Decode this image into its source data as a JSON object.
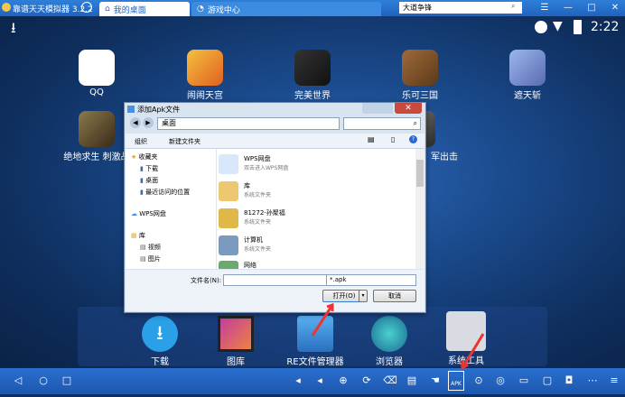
{
  "titlebar": {
    "app_name": "靠谱天天模拟器 3.2.2",
    "tab_desktop": "我的桌面",
    "tab_game_center": "游戏中心",
    "search_value": "大道争锋"
  },
  "statusbar": {
    "time": "2:22"
  },
  "desktop": {
    "row1": [
      {
        "label": "QQ",
        "icon": "qq-icon",
        "color": "#ffffff"
      },
      {
        "label": "闹闹天宫",
        "icon": "game-icon",
        "color": "#f5a623"
      },
      {
        "label": "完美世界",
        "icon": "game-icon",
        "color": "#2a2a2a"
      },
      {
        "label": "乐可三国",
        "icon": "game-icon",
        "color": "#8a5a2a"
      },
      {
        "label": "遮天斩",
        "icon": "game-icon",
        "color": "#7a9ad8"
      }
    ],
    "row2": [
      {
        "label": "绝地求生 刺激战",
        "icon": "game-icon",
        "color": "#6a5a3a"
      },
      {
        "label": "军出击",
        "icon": "game-icon",
        "color": "#4a4a4a"
      }
    ]
  },
  "dock": [
    {
      "label": "下载",
      "icon": "download-icon"
    },
    {
      "label": "图库",
      "icon": "gallery-icon"
    },
    {
      "label": "RE文件管理器",
      "icon": "folder-icon"
    },
    {
      "label": "浏览器",
      "icon": "browser-icon"
    },
    {
      "label": "系统工具",
      "icon": "tools-icon"
    }
  ],
  "dialog": {
    "title": "添加Apk文件",
    "address": "桌面",
    "toolbar_organize": "组织",
    "toolbar_new_folder": "新建文件夹",
    "nav_items": [
      {
        "label": "收藏夹",
        "indent": 0
      },
      {
        "label": "下载",
        "indent": 1
      },
      {
        "label": "桌面",
        "indent": 1
      },
      {
        "label": "最近访问的位置",
        "indent": 1
      },
      {
        "label": "WPS网盘",
        "indent": 0
      },
      {
        "label": "库",
        "indent": 0
      },
      {
        "label": "视频",
        "indent": 1
      },
      {
        "label": "图片",
        "indent": 1
      }
    ],
    "files": [
      {
        "name": "WPS网盘",
        "desc": "双击进入WPS网盘",
        "icon": "cloud-icon",
        "color": "#4a90e2"
      },
      {
        "name": "库",
        "desc": "系统文件夹",
        "icon": "library-icon",
        "color": "#e8c060"
      },
      {
        "name": "81272-孙聚福",
        "desc": "系统文件夹",
        "icon": "user-folder-icon",
        "color": "#d8b040"
      },
      {
        "name": "计算机",
        "desc": "系统文件夹",
        "icon": "computer-icon",
        "color": "#6a8ab0"
      },
      {
        "name": "网络",
        "desc": "",
        "icon": "network-icon",
        "color": "#5a9a5a"
      }
    ],
    "filename_label": "文件名(N):",
    "filename_value": "",
    "filetype_value": "*.apk",
    "open_button": "打开(O)",
    "cancel_button": "取消"
  },
  "navbar": {
    "apk_label": "APK"
  }
}
